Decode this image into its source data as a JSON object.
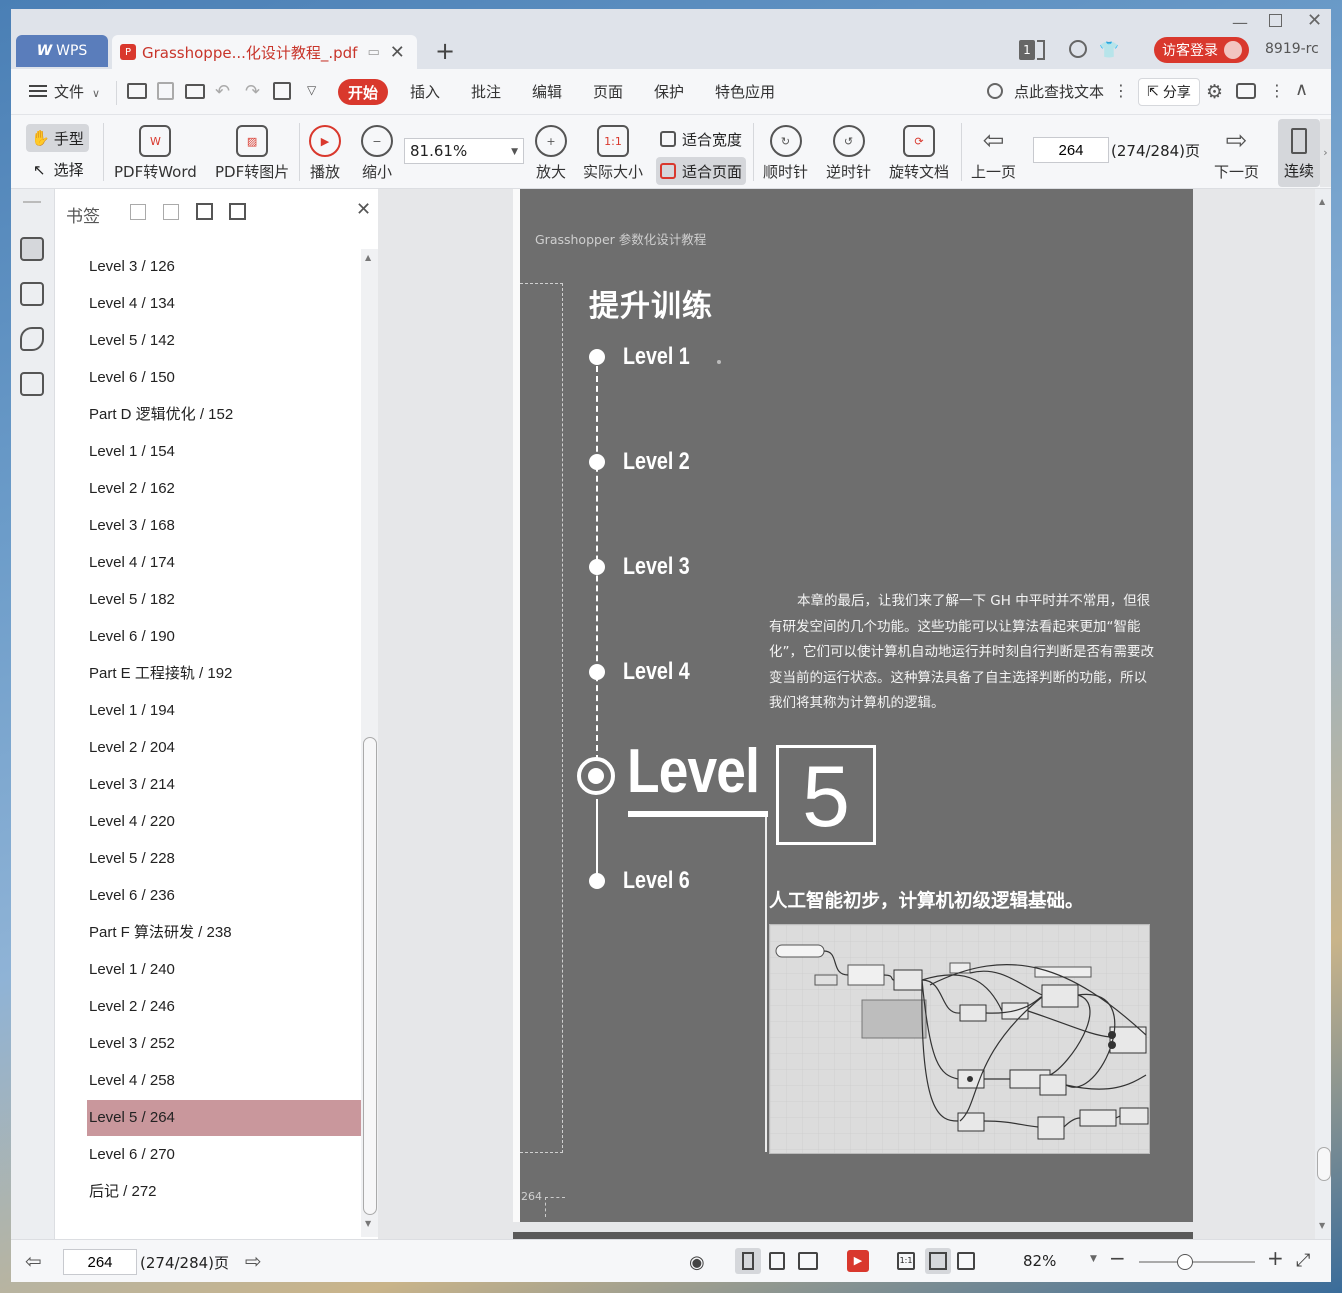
{
  "titlebar": {
    "app_label": "WPS",
    "doc_tab_title": "Grasshoppe...化设计教程_.pdf",
    "page_count_badge": "1",
    "login_label": "访客登录",
    "user_id": "8919-rc"
  },
  "menubar": {
    "file_label": "文件",
    "tabs": [
      "开始",
      "插入",
      "批注",
      "编辑",
      "页面",
      "保护",
      "特色应用"
    ],
    "search_label": "点此查找文本",
    "share_label": "分享"
  },
  "ribbon": {
    "hand_label": "手型",
    "select_label": "选择",
    "pdf_to_word": "PDF转Word",
    "pdf_to_image": "PDF转图片",
    "play": "播放",
    "zoom_out": "缩小",
    "zoom_value": "81.61%",
    "zoom_in": "放大",
    "actual_size": "实际大小",
    "fit_width": "适合宽度",
    "fit_page": "适合页面",
    "rotate_cw": "顺时针",
    "rotate_ccw": "逆时针",
    "rotate_doc": "旋转文档",
    "prev_page": "上一页",
    "page_input": "264",
    "page_total": "(274/284)页",
    "next_page": "下一页",
    "continuous": "连续"
  },
  "bookmarks": {
    "title": "书签",
    "items": [
      "Level 3 / 126",
      "Level 4 / 134",
      "Level 5 / 142",
      "Level 6 / 150",
      "Part D  逻辑优化 / 152",
      "Level 1 / 154",
      "Level 2 / 162",
      "Level 3 / 168",
      "Level 4 / 174",
      "Level 5 / 182",
      "Level 6 / 190",
      "Part E  工程接轨 / 192",
      "Level 1 / 194",
      "Level 2 / 204",
      "Level 3 / 214",
      "Level 4 / 220",
      "Level 5 / 228",
      "Level 6 / 236",
      "Part F  算法研发 / 238",
      "Level 1 / 240",
      "Level 2 / 246",
      "Level 3 / 252",
      "Level 4 / 258",
      "Level 5 / 264",
      "Level 6 / 270",
      "后记 / 272"
    ],
    "selected_index": 23,
    "selected_color": "#c9979c"
  },
  "pdf_page": {
    "header": "Grasshopper 参数化设计教程",
    "section_title": "提升训练",
    "levels": [
      "Level 1",
      "Level 2",
      "Level 3",
      "Level 4",
      "Level 6"
    ],
    "current_level_word": "Level",
    "current_level_number": "5",
    "intro": "本章的最后，让我们来了解一下 GH 中平时并不常用，但很有研发空间的几个功能。这些功能可以让算法看起来更加“智能化”，它们可以使计算机自动地运行并时刻自行判断是否有需要改变当前的运行状态。这种算法具备了自主选择判断的功能，所以我们将其称为计算机的逻辑。",
    "subtitle": "人工智能初步，计算机初级逻辑基础。",
    "page_number": "264"
  },
  "statusbar": {
    "page_input": "264",
    "page_total": "(274/284)页",
    "zoom_value": "82%"
  },
  "colors": {
    "accent": "#d9382d",
    "page_bg": "#6e6e6e"
  }
}
